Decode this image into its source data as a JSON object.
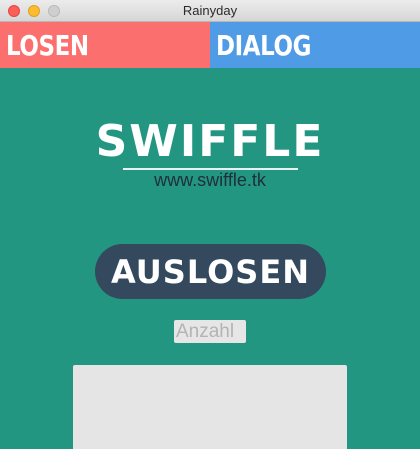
{
  "window": {
    "title": "Rainyday"
  },
  "tabs": [
    {
      "label": "LOSEN",
      "color": "#fb6f6f"
    },
    {
      "label": "DIALOG",
      "color": "#4f9be6"
    }
  ],
  "main": {
    "background": "#229680",
    "logo": "SWIFFLE",
    "url": "www.swiffle.tk",
    "action_button": "AUSLOSEN",
    "count_input": {
      "value": "",
      "placeholder": "Anzahl"
    }
  }
}
